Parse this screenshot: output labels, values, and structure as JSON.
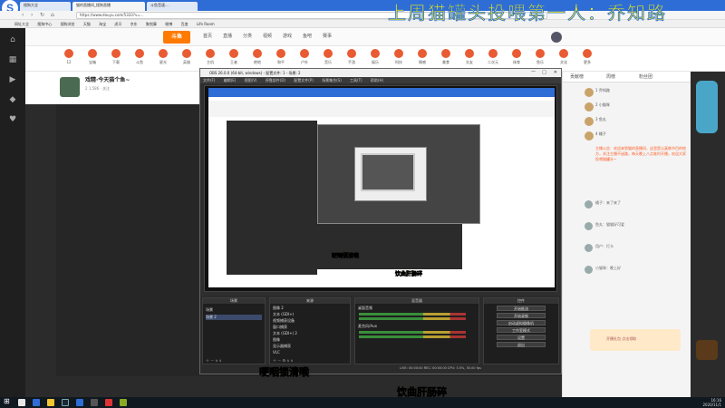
{
  "browser": {
    "logo": "S",
    "tabs": [
      "搜狗大全",
      "猫的直播间_搜狗直播",
      "斗鱼音速..."
    ],
    "url": "https://www.douyu.com/5333?v=...",
    "bookmarks": [
      "网址大全",
      "搜狗中心",
      "搜狗浏览",
      "天猫",
      "淘宝",
      "虎牙",
      "京东",
      "聚划算",
      "微博",
      "百度",
      "Life Room"
    ]
  },
  "overlay": {
    "title": "上周猫罐头投喂第一人：乔知路"
  },
  "douyu": {
    "logo": "斗鱼",
    "nav": [
      "首页",
      "直播",
      "分类",
      "视频",
      "游戏",
      "鱼吧",
      "赛事"
    ],
    "categories": [
      "12",
      "宝箱",
      "下载",
      "斗鱼",
      "星光",
      "英雄",
      "主机",
      "王者",
      "绝地",
      "和平",
      "户外",
      "音乐",
      "手游",
      "娱乐",
      "科技",
      "情感",
      "美食",
      "交友",
      "二次元",
      "体育",
      "鱼乐",
      "文化",
      "更多"
    ],
    "room": {
      "title": "戏精·今天猫个鱼~",
      "subtitle": "2 1,586  ·  关注",
      "follow_count": "1,586"
    }
  },
  "right_panel": {
    "tabs": [
      "贡献榜",
      "周榜",
      "粉丝团"
    ],
    "ranks": [
      "1  乔知路",
      "2  小猫咪",
      "3  鱼丸",
      "4  橘子"
    ],
    "notice": "主播公告：欢迎来到猫的直播间，这里是认真做节目的地方，关注主播不迷路，每天晚上八点准时开播，欢迎大家投喂猫罐头~",
    "chat": [
      "橘子：来了来了",
      "鱼丸：猫猫好可爱",
      "用户：打卡",
      "小猫咪：晚上好"
    ],
    "promo": "开播礼包 点击领取"
  },
  "obs": {
    "title": "OBS 26.0.0 (64-bit, windows) - 配置文件: 1 - 场景: 2",
    "menu": [
      "文件(F)",
      "编辑(E)",
      "视图(V)",
      "停靠部件(D)",
      "配置文件(P)",
      "场景集合(S)",
      "工具(T)",
      "帮助(H)"
    ],
    "docks": {
      "scenes_title": "场景",
      "scenes": [
        "场景",
        "场景 2"
      ],
      "sources_title": "来源",
      "sources": [
        "图像 2",
        "文本 (GDI+)",
        "视频捕获设备",
        "窗口捕获",
        "文本 (GDI+) 2",
        "图像",
        "显示器捕获",
        "VLC"
      ],
      "mixer_title": "混音器",
      "mixer": [
        "桌面音频",
        "麦克风/Aux"
      ],
      "controls_title": "控件",
      "controls": [
        "开始推流",
        "开始录制",
        "启动虚拟摄像机",
        "工作室模式",
        "设置",
        "退出"
      ],
      "status": "LIVE: 00:00:00   REC: 00:00:00   CPU: 3.5%, 30.00 fps"
    }
  },
  "subtitles": {
    "left": "哽咽锁清喉",
    "bottom": "饮曲肝肠碎"
  },
  "taskbar": {
    "time": "16:16",
    "date": "2020/11/1"
  }
}
